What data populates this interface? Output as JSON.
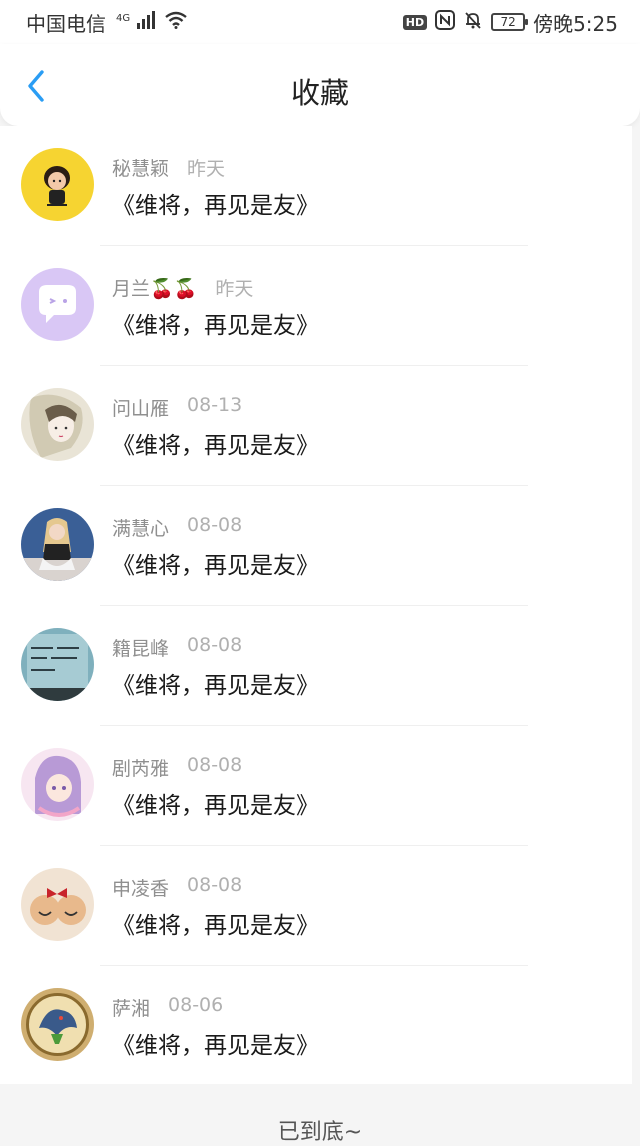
{
  "status_bar": {
    "carrier": "中国电信",
    "network": "4G",
    "hd_badge": "HD",
    "battery_level": "72",
    "time": "傍晚5:25"
  },
  "header": {
    "title": "收藏"
  },
  "favorites": [
    {
      "user": "秘慧颖",
      "date": "昨天",
      "title": "《维将，再见是友》"
    },
    {
      "user": "月兰🍒🍒",
      "date": "昨天",
      "title": "《维将，再见是友》"
    },
    {
      "user": "问山雁",
      "date": "08-13",
      "title": "《维将，再见是友》"
    },
    {
      "user": "满慧心",
      "date": "08-08",
      "title": "《维将，再见是友》"
    },
    {
      "user": "籍昆峰",
      "date": "08-08",
      "title": "《维将，再见是友》"
    },
    {
      "user": "剧芮雅",
      "date": "08-08",
      "title": "《维将，再见是友》"
    },
    {
      "user": "申凌香",
      "date": "08-08",
      "title": "《维将，再见是友》"
    },
    {
      "user": "萨湘",
      "date": "08-06",
      "title": "《维将，再见是友》"
    }
  ],
  "footer": {
    "end_text": "已到底~"
  },
  "colors": {
    "accent": "#2a9df4",
    "background": "#f5f5f5"
  }
}
